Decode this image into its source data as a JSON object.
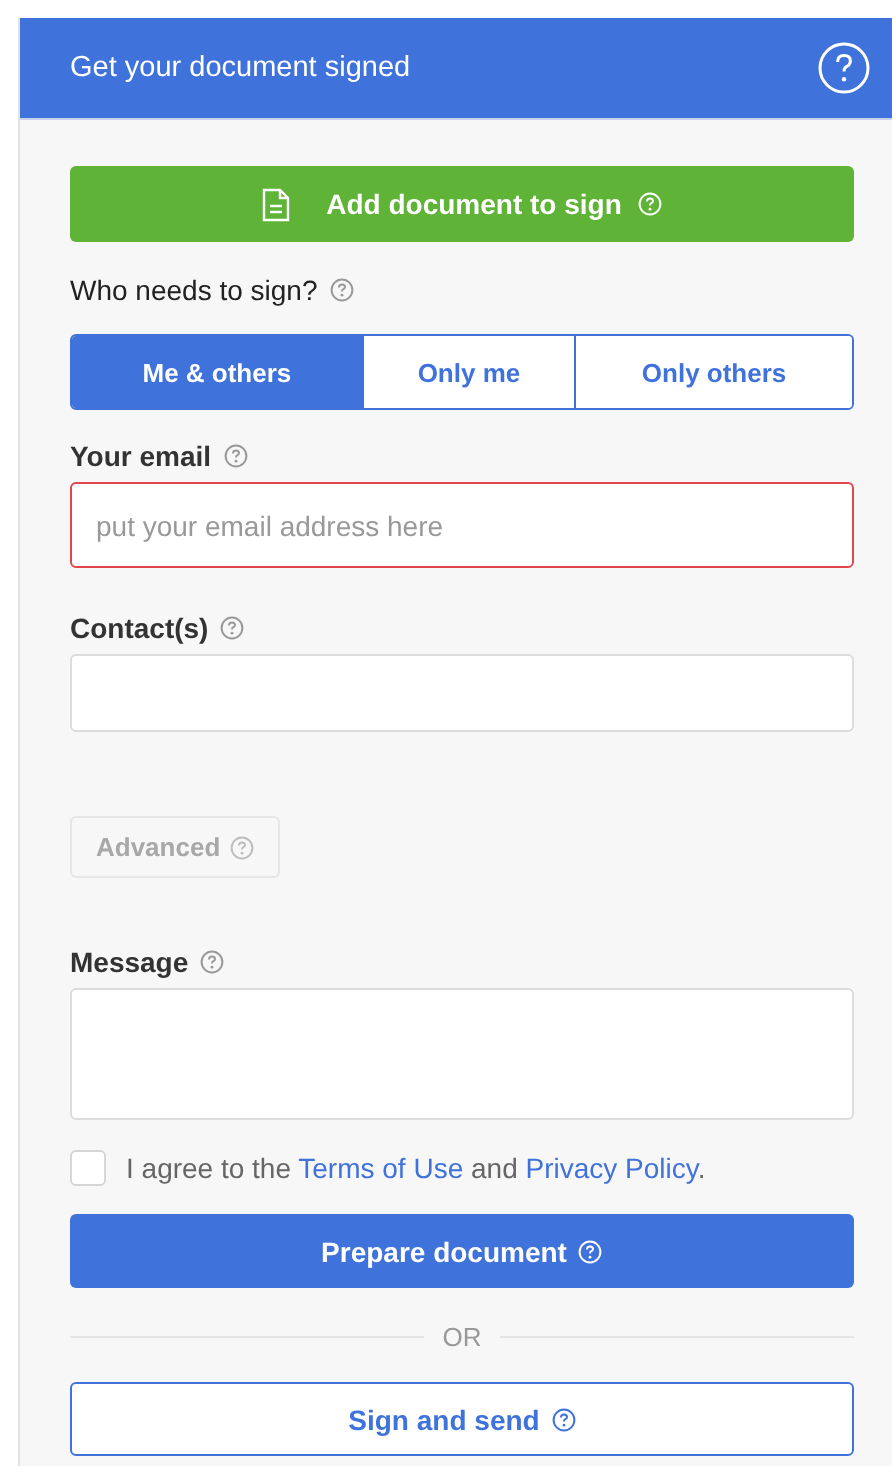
{
  "header": {
    "title": "Get your document signed"
  },
  "add_button": {
    "label": "Add document to sign"
  },
  "signers": {
    "label": "Who needs to sign?",
    "options": [
      {
        "label": "Me & others",
        "selected": true
      },
      {
        "label": "Only me",
        "selected": false
      },
      {
        "label": "Only others",
        "selected": false
      }
    ]
  },
  "email": {
    "label": "Your email",
    "placeholder": "put your email address here",
    "invalid": true
  },
  "contacts": {
    "label": "Contact(s)"
  },
  "advanced": {
    "label": "Advanced",
    "disabled": true
  },
  "message": {
    "label": "Message"
  },
  "agree": {
    "checked": false,
    "text_before": "I agree to the",
    "terms_link": "Terms of Use",
    "text_middle": "and",
    "privacy_link": "Privacy Policy",
    "text_after": "."
  },
  "prepare_button": {
    "label": "Prepare document"
  },
  "separator": {
    "label": "OR"
  },
  "sign_button": {
    "label": "Sign and send"
  }
}
